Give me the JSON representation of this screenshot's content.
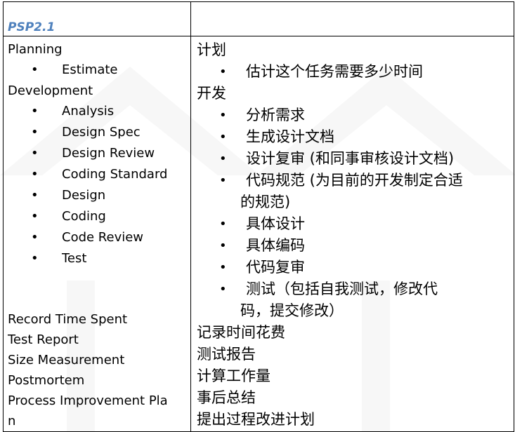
{
  "header": {
    "version": "PSP2.1",
    "right_header": ""
  },
  "left_column": {
    "planning": "Planning",
    "planning_items": [
      "Estimate"
    ],
    "development": "Development",
    "development_items": [
      "Analysis",
      "Design Spec",
      "Design Review",
      "Coding Standard",
      "Design",
      "Coding",
      "Code Review",
      "Test"
    ],
    "tail_items": [
      "Record Time Spent",
      "Test Report",
      "Size Measurement",
      "Postmortem",
      "Process Improvement Pla",
      "n"
    ]
  },
  "right_column": {
    "planning": "计划",
    "planning_items": [
      "估计这个任务需要多少时间"
    ],
    "development": "开发",
    "development_items": [
      {
        "line1": "分析需求"
      },
      {
        "line1": "生成设计文档"
      },
      {
        "line1": "设计复审 (和同事审核设计文档)"
      },
      {
        "line1": "代码规范 (为目前的开发制定合适",
        "line2": "的规范)"
      },
      {
        "line1": "具体设计"
      },
      {
        "line1": "具体编码"
      },
      {
        "line1": "代码复审"
      },
      {
        "line1": "测试（包括自我测试，修改代",
        "line2": "码，提交修改）"
      }
    ],
    "tail_items": [
      "记录时间花费",
      "测试报告",
      "计算工作量",
      "事后总结",
      "提出过程改进计划"
    ]
  }
}
